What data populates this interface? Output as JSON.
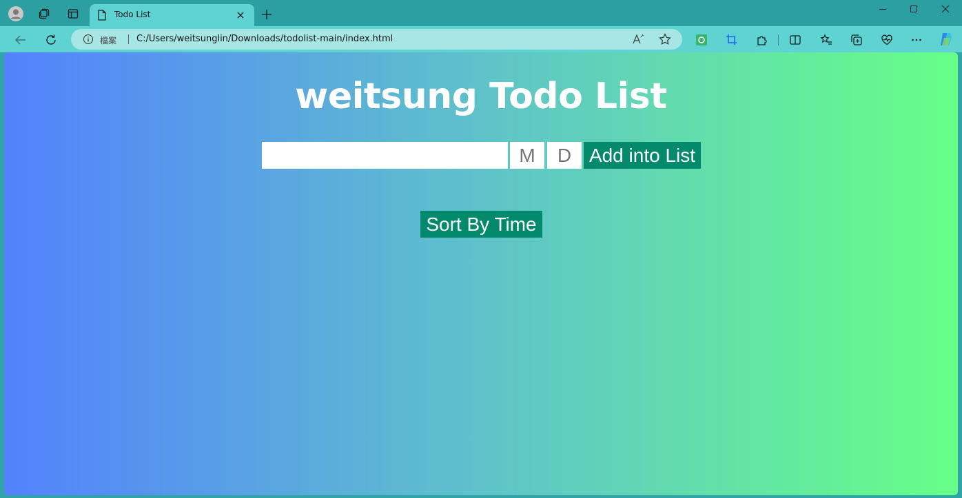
{
  "browser": {
    "tab": {
      "title": "Todo List"
    },
    "address": {
      "file_label": "檔案",
      "url": "C:/Users/weitsunglin/Downloads/todolist-main/index.html"
    }
  },
  "page": {
    "title": "weitsung Todo List",
    "todo_input": {
      "value": "",
      "placeholder": ""
    },
    "month_input": {
      "placeholder": "M"
    },
    "day_input": {
      "placeholder": "D"
    },
    "add_button": "Add into List",
    "sort_button": "Sort By Time"
  },
  "colors": {
    "gradient_start": "#5381fe",
    "gradient_end": "#66ff87",
    "button_bg": "#03896c",
    "title_text": "#ffffff"
  }
}
